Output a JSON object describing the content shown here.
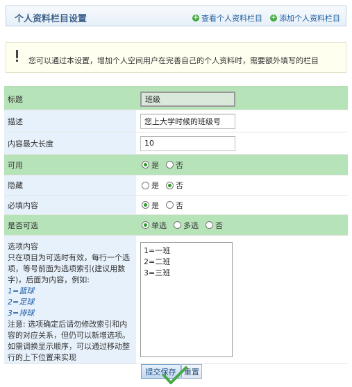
{
  "header": {
    "title": "个人资料栏目设置",
    "view_link": "查看个人资料栏目",
    "add_link": "添加个人资料栏目"
  },
  "tip": {
    "text": "您可以通过本设置，增加个人空间用户在完善自己的个人资料时，需要额外填写的栏目"
  },
  "form": {
    "title_label": "标题",
    "title_value": "班级",
    "desc_label": "描述",
    "desc_value": "您上大学时候的班级号",
    "maxlen_label": "内容最大长度",
    "maxlen_value": "10",
    "available_label": "可用",
    "available_yes": "是",
    "available_no": "否",
    "available_selected": "是",
    "hidden_label": "隐藏",
    "hidden_yes": "是",
    "hidden_no": "否",
    "hidden_selected": "否",
    "required_label": "必填内容",
    "required_yes": "是",
    "required_no": "否",
    "required_selected": "是",
    "selectable_label": "是否可选",
    "selectable_single": "单选",
    "selectable_multi": "多选",
    "selectable_no": "否",
    "selectable_selected": "单选",
    "options_title": "选项内容",
    "options_help": "只在项目为可选时有效，每行一个选项，等号前面为选项索引(建议用数字)，后面为内容，例如:",
    "options_example_1": "1=篮球",
    "options_example_2": "2=足球",
    "options_example_3": "3=排球",
    "options_note": "注意: 选项确定后请勿修改索引和内容的对应关系，但仍可以新增选项。如需调换显示顺序，可以通过移动整行的上下位置来实现",
    "options_lines": [
      "1=一班",
      "2=二班",
      "3=三班"
    ]
  },
  "buttons": {
    "submit": "提交保存",
    "reset": "重置"
  },
  "colors": {
    "green_row": "#b7e3b8",
    "blue_label": "#e7f1fb",
    "link": "#1a5a9e"
  }
}
